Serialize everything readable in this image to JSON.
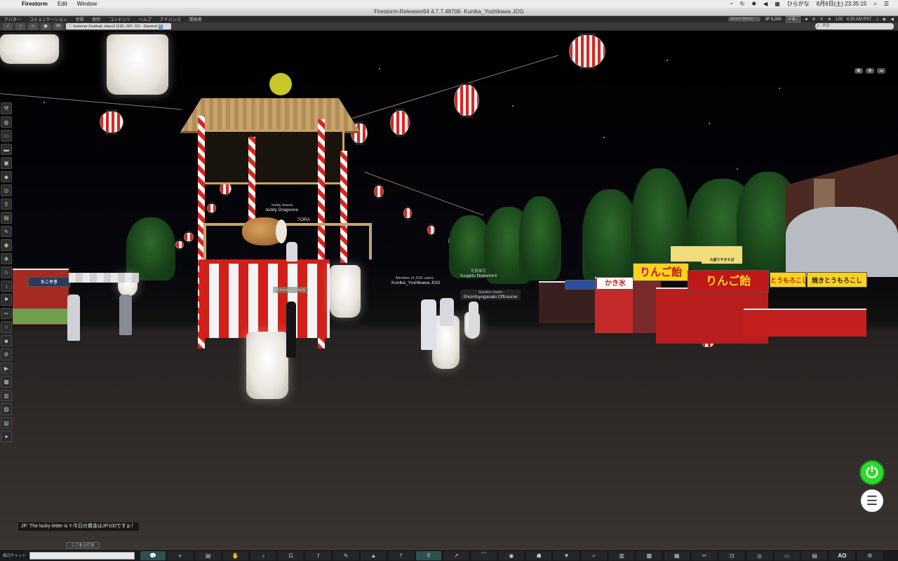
{
  "mac_menubar": {
    "app_name": "Firestorm",
    "items": [
      "Edit",
      "Window"
    ],
    "right": {
      "input_method": "ひらがな",
      "date_time": "8月6日(土) 23:35:15"
    }
  },
  "window": {
    "title": "Firestorm-Releasex64 4.7.7.48706- Kunika_Yoshikawa JOG"
  },
  "viewer_menu": {
    "items": [
      "アバター",
      "コミュニケーション",
      "世界",
      "制作",
      "コンテンツ",
      "ヘルプ",
      "アドバンス",
      "開発者"
    ],
    "search_placeholder": "Search Menus",
    "balance": "JP 3,200",
    "buy_label": "JP購入",
    "fps": "128",
    "time": "6:35 AM PST"
  },
  "navbar": {
    "location": "Summer Festival, otaru2 (192, 187, 31) - General",
    "maturity": "G",
    "search_placeholder": "検索"
  },
  "scene": {
    "tags": {
      "teddy_group": "teddy Island",
      "teddy_name": "teddy Dragoone",
      "tora": "TORA",
      "dancer": "tzawa Poniady",
      "kunika_group": "Member of JOG users",
      "kunika_name": "Kunika_Yoshikawa JOG",
      "fuugetu_group": "花鳥風月",
      "fuugetu_name": "fuugetu flowerbird",
      "garden_group": "Garden Oasis",
      "garden_name": "Shionfuyugasaki Offcourse"
    },
    "signs": {
      "kakigori": "かき氷",
      "ringoame_1": "りんご飴",
      "ringoame_2": "りんご飴",
      "tomorokoshi": "とうもろこし",
      "yaki_tomorokoshi": "焼きとうもろこし",
      "yakisoba": "大盛りやきそば",
      "left_stall": "たこやき"
    }
  },
  "left_toolbar": {
    "icons": [
      "wrench-icon",
      "globe-icon",
      "chat-icon",
      "speech-icon",
      "profile-icon",
      "tag-icon",
      "compass-icon",
      "pin-icon",
      "landmark-icon",
      "build-icon",
      "camera-icon",
      "move-icon",
      "people-icon",
      "sound-icon",
      "walk-icon",
      "tools-icon",
      "bubble-icon",
      "group-icon",
      "gear-icon",
      "film-icon",
      "box-icon",
      "bag-icon",
      "book-icon",
      "store-icon",
      "avatar-icon"
    ]
  },
  "chat": {
    "message": "JP: The lucky letter is Y.今日の賞金はJP100ですぉ！",
    "toggle_label": "ここを上げる",
    "input_label": "周辺チャット"
  },
  "bottom_bar": {
    "ao_label": "AO"
  }
}
